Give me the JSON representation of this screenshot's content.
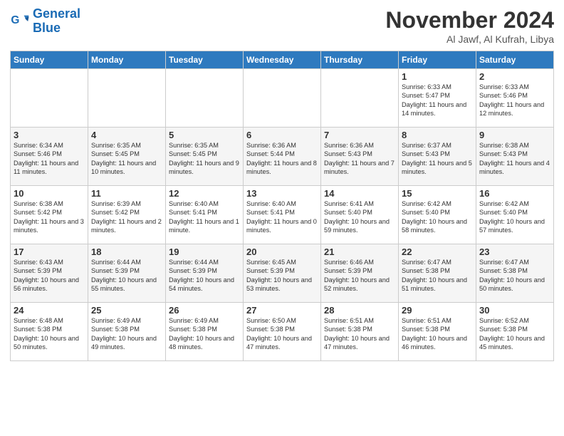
{
  "logo": {
    "line1": "General",
    "line2": "Blue"
  },
  "title": "November 2024",
  "location": "Al Jawf, Al Kufrah, Libya",
  "days_of_week": [
    "Sunday",
    "Monday",
    "Tuesday",
    "Wednesday",
    "Thursday",
    "Friday",
    "Saturday"
  ],
  "weeks": [
    [
      {
        "day": "",
        "info": ""
      },
      {
        "day": "",
        "info": ""
      },
      {
        "day": "",
        "info": ""
      },
      {
        "day": "",
        "info": ""
      },
      {
        "day": "",
        "info": ""
      },
      {
        "day": "1",
        "info": "Sunrise: 6:33 AM\nSunset: 5:47 PM\nDaylight: 11 hours and 14 minutes."
      },
      {
        "day": "2",
        "info": "Sunrise: 6:33 AM\nSunset: 5:46 PM\nDaylight: 11 hours and 12 minutes."
      }
    ],
    [
      {
        "day": "3",
        "info": "Sunrise: 6:34 AM\nSunset: 5:46 PM\nDaylight: 11 hours and 11 minutes."
      },
      {
        "day": "4",
        "info": "Sunrise: 6:35 AM\nSunset: 5:45 PM\nDaylight: 11 hours and 10 minutes."
      },
      {
        "day": "5",
        "info": "Sunrise: 6:35 AM\nSunset: 5:45 PM\nDaylight: 11 hours and 9 minutes."
      },
      {
        "day": "6",
        "info": "Sunrise: 6:36 AM\nSunset: 5:44 PM\nDaylight: 11 hours and 8 minutes."
      },
      {
        "day": "7",
        "info": "Sunrise: 6:36 AM\nSunset: 5:43 PM\nDaylight: 11 hours and 7 minutes."
      },
      {
        "day": "8",
        "info": "Sunrise: 6:37 AM\nSunset: 5:43 PM\nDaylight: 11 hours and 5 minutes."
      },
      {
        "day": "9",
        "info": "Sunrise: 6:38 AM\nSunset: 5:43 PM\nDaylight: 11 hours and 4 minutes."
      }
    ],
    [
      {
        "day": "10",
        "info": "Sunrise: 6:38 AM\nSunset: 5:42 PM\nDaylight: 11 hours and 3 minutes."
      },
      {
        "day": "11",
        "info": "Sunrise: 6:39 AM\nSunset: 5:42 PM\nDaylight: 11 hours and 2 minutes."
      },
      {
        "day": "12",
        "info": "Sunrise: 6:40 AM\nSunset: 5:41 PM\nDaylight: 11 hours and 1 minute."
      },
      {
        "day": "13",
        "info": "Sunrise: 6:40 AM\nSunset: 5:41 PM\nDaylight: 11 hours and 0 minutes."
      },
      {
        "day": "14",
        "info": "Sunrise: 6:41 AM\nSunset: 5:40 PM\nDaylight: 10 hours and 59 minutes."
      },
      {
        "day": "15",
        "info": "Sunrise: 6:42 AM\nSunset: 5:40 PM\nDaylight: 10 hours and 58 minutes."
      },
      {
        "day": "16",
        "info": "Sunrise: 6:42 AM\nSunset: 5:40 PM\nDaylight: 10 hours and 57 minutes."
      }
    ],
    [
      {
        "day": "17",
        "info": "Sunrise: 6:43 AM\nSunset: 5:39 PM\nDaylight: 10 hours and 56 minutes."
      },
      {
        "day": "18",
        "info": "Sunrise: 6:44 AM\nSunset: 5:39 PM\nDaylight: 10 hours and 55 minutes."
      },
      {
        "day": "19",
        "info": "Sunrise: 6:44 AM\nSunset: 5:39 PM\nDaylight: 10 hours and 54 minutes."
      },
      {
        "day": "20",
        "info": "Sunrise: 6:45 AM\nSunset: 5:39 PM\nDaylight: 10 hours and 53 minutes."
      },
      {
        "day": "21",
        "info": "Sunrise: 6:46 AM\nSunset: 5:39 PM\nDaylight: 10 hours and 52 minutes."
      },
      {
        "day": "22",
        "info": "Sunrise: 6:47 AM\nSunset: 5:38 PM\nDaylight: 10 hours and 51 minutes."
      },
      {
        "day": "23",
        "info": "Sunrise: 6:47 AM\nSunset: 5:38 PM\nDaylight: 10 hours and 50 minutes."
      }
    ],
    [
      {
        "day": "24",
        "info": "Sunrise: 6:48 AM\nSunset: 5:38 PM\nDaylight: 10 hours and 50 minutes."
      },
      {
        "day": "25",
        "info": "Sunrise: 6:49 AM\nSunset: 5:38 PM\nDaylight: 10 hours and 49 minutes."
      },
      {
        "day": "26",
        "info": "Sunrise: 6:49 AM\nSunset: 5:38 PM\nDaylight: 10 hours and 48 minutes."
      },
      {
        "day": "27",
        "info": "Sunrise: 6:50 AM\nSunset: 5:38 PM\nDaylight: 10 hours and 47 minutes."
      },
      {
        "day": "28",
        "info": "Sunrise: 6:51 AM\nSunset: 5:38 PM\nDaylight: 10 hours and 47 minutes."
      },
      {
        "day": "29",
        "info": "Sunrise: 6:51 AM\nSunset: 5:38 PM\nDaylight: 10 hours and 46 minutes."
      },
      {
        "day": "30",
        "info": "Sunrise: 6:52 AM\nSunset: 5:38 PM\nDaylight: 10 hours and 45 minutes."
      }
    ]
  ]
}
